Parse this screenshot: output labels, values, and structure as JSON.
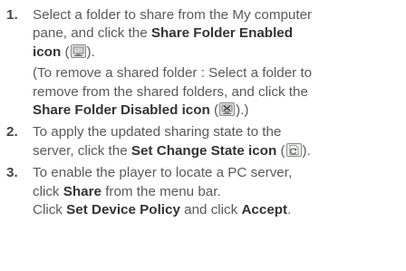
{
  "steps": [
    {
      "number": "1.",
      "line1": "Select a folder to share from the My computer",
      "line2": "pane, and click the ",
      "bold1": "Share Folder Enabled",
      "bold2": "icon",
      "tail1_open": " (",
      "tail1_close": ").",
      "note_line1": "(To remove a shared folder : Select a folder to",
      "note_line2": "remove from the shared folders, and click the",
      "note_bold": "Share Folder Disabled icon",
      "note_open": " (",
      "note_close": ").)"
    },
    {
      "number": "2.",
      "line1": "To apply the updated sharing state to the",
      "line2_prefix": "server, click the ",
      "bold": "Set Change State icon",
      "open": " (",
      "close": ")."
    },
    {
      "number": "3.",
      "line1": "To enable the player to locate a PC server,",
      "line2_prefix": "click ",
      "bold_share": "Share",
      "line2_suffix": " from the menu bar.",
      "line3_prefix": "Click ",
      "bold_policy": "Set Device Policy",
      "line3_mid": " and click ",
      "bold_accept": "Accept",
      "line3_suffix": "."
    }
  ],
  "icons": {
    "share_enabled": "share-folder-enabled-icon",
    "share_disabled": "share-folder-disabled-icon",
    "set_change_state": "set-change-state-icon"
  }
}
